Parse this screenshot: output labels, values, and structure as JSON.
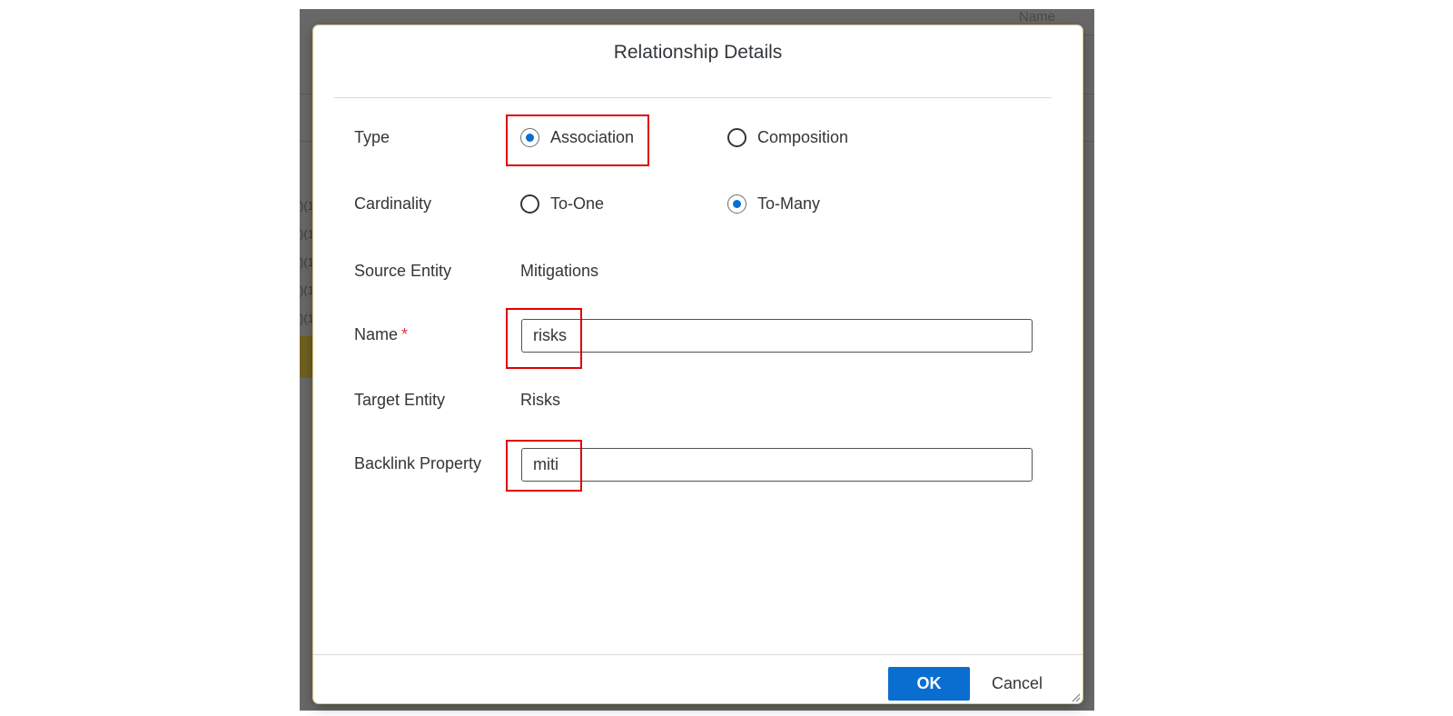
{
  "background": {
    "top_fragment": "Name",
    "left_fragments": [
      ")(1",
      ")(1",
      ")(1",
      ")(1",
      ")(1"
    ]
  },
  "dialog": {
    "title": "Relationship Details",
    "type": {
      "label": "Type",
      "options": [
        {
          "label": "Association",
          "selected": true
        },
        {
          "label": "Composition",
          "selected": false
        }
      ]
    },
    "cardinality": {
      "label": "Cardinality",
      "options": [
        {
          "label": "To-One",
          "selected": false
        },
        {
          "label": "To-Many",
          "selected": true
        }
      ]
    },
    "source_entity": {
      "label": "Source Entity",
      "value": "Mitigations"
    },
    "name": {
      "label": "Name",
      "required_marker": "*",
      "value": "risks"
    },
    "target_entity": {
      "label": "Target Entity",
      "value": "Risks"
    },
    "backlink_property": {
      "label": "Backlink Property",
      "value": "miti"
    },
    "buttons": {
      "ok": "OK",
      "cancel": "Cancel"
    }
  },
  "colors": {
    "accent": "#0a6ed1",
    "highlight": "#e00000",
    "required": "#e9353a",
    "backdrop": "#686868"
  }
}
